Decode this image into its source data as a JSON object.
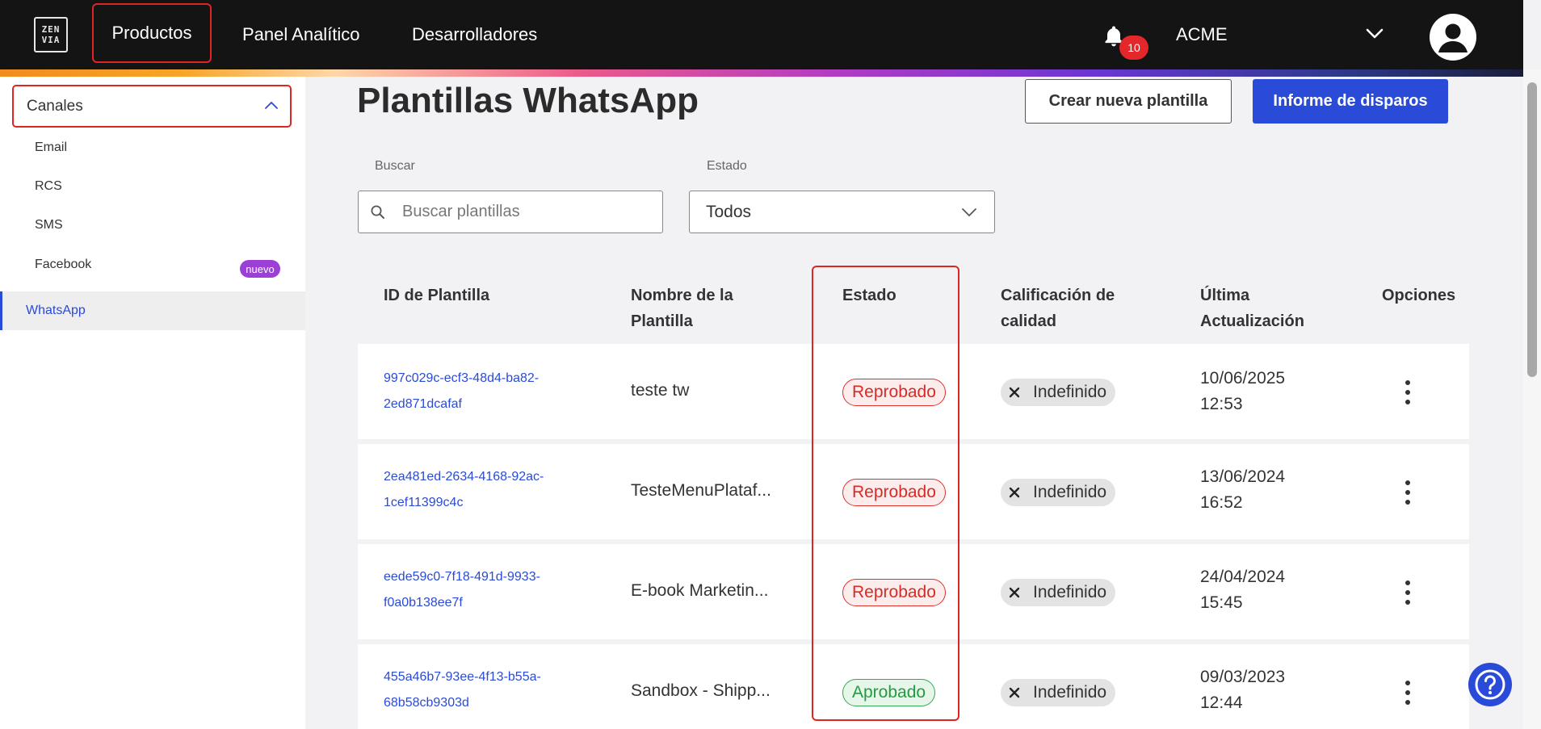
{
  "header": {
    "logo_lines": [
      "ZEN",
      "VIA"
    ],
    "nav": [
      "Productos",
      "Panel Analítico",
      "Desarrolladores"
    ],
    "notifications_count": "10",
    "org_name": "ACME"
  },
  "sidebar": {
    "section_label": "Canales",
    "items": [
      "Email",
      "RCS",
      "SMS",
      "Facebook",
      "WhatsApp"
    ],
    "new_badge": "nuevo"
  },
  "main": {
    "title": "Plantillas WhatsApp",
    "create_button": "Crear nueva plantilla",
    "report_button": "Informe de disparos",
    "search_label": "Buscar",
    "search_placeholder": "Buscar plantillas",
    "status_label": "Estado",
    "status_value": "Todos"
  },
  "table": {
    "headers": {
      "id": "ID de Plantilla",
      "name_1": "Nombre de la",
      "name_2": "Plantilla",
      "status": "Estado",
      "quality_1": "Calificación de",
      "quality_2": "calidad",
      "updated_1": "Última",
      "updated_2": "Actualización",
      "options": "Opciones"
    },
    "rows": [
      {
        "id_1": "997c029c-ecf3-48d4-ba82-",
        "id_2": "2ed871dcafaf",
        "name": "teste tw",
        "status": "Reprobado",
        "quality": "Indefinido",
        "date": "10/06/2025",
        "time": "12:53"
      },
      {
        "id_1": "2ea481ed-2634-4168-92ac-",
        "id_2": "1cef11399c4c",
        "name": "TesteMenuPlataf...",
        "status": "Reprobado",
        "quality": "Indefinido",
        "date": "13/06/2024",
        "time": "16:52"
      },
      {
        "id_1": "eede59c0-7f18-491d-9933-",
        "id_2": "f0a0b138ee7f",
        "name": "E-book Marketin...",
        "status": "Reprobado",
        "quality": "Indefinido",
        "date": "24/04/2024",
        "time": "15:45"
      },
      {
        "id_1": "455a46b7-93ee-4f13-b55a-",
        "id_2": "68b58cb9303d",
        "name": "Sandbox - Shipp...",
        "status": "Aprobado",
        "quality": "Indefinido",
        "date": "09/03/2023",
        "time": "12:44"
      }
    ]
  },
  "colors": {
    "accent": "#2a4bd7",
    "rejected": "#d92b25",
    "approved": "#249a43",
    "badge": "#9b3fd6"
  }
}
